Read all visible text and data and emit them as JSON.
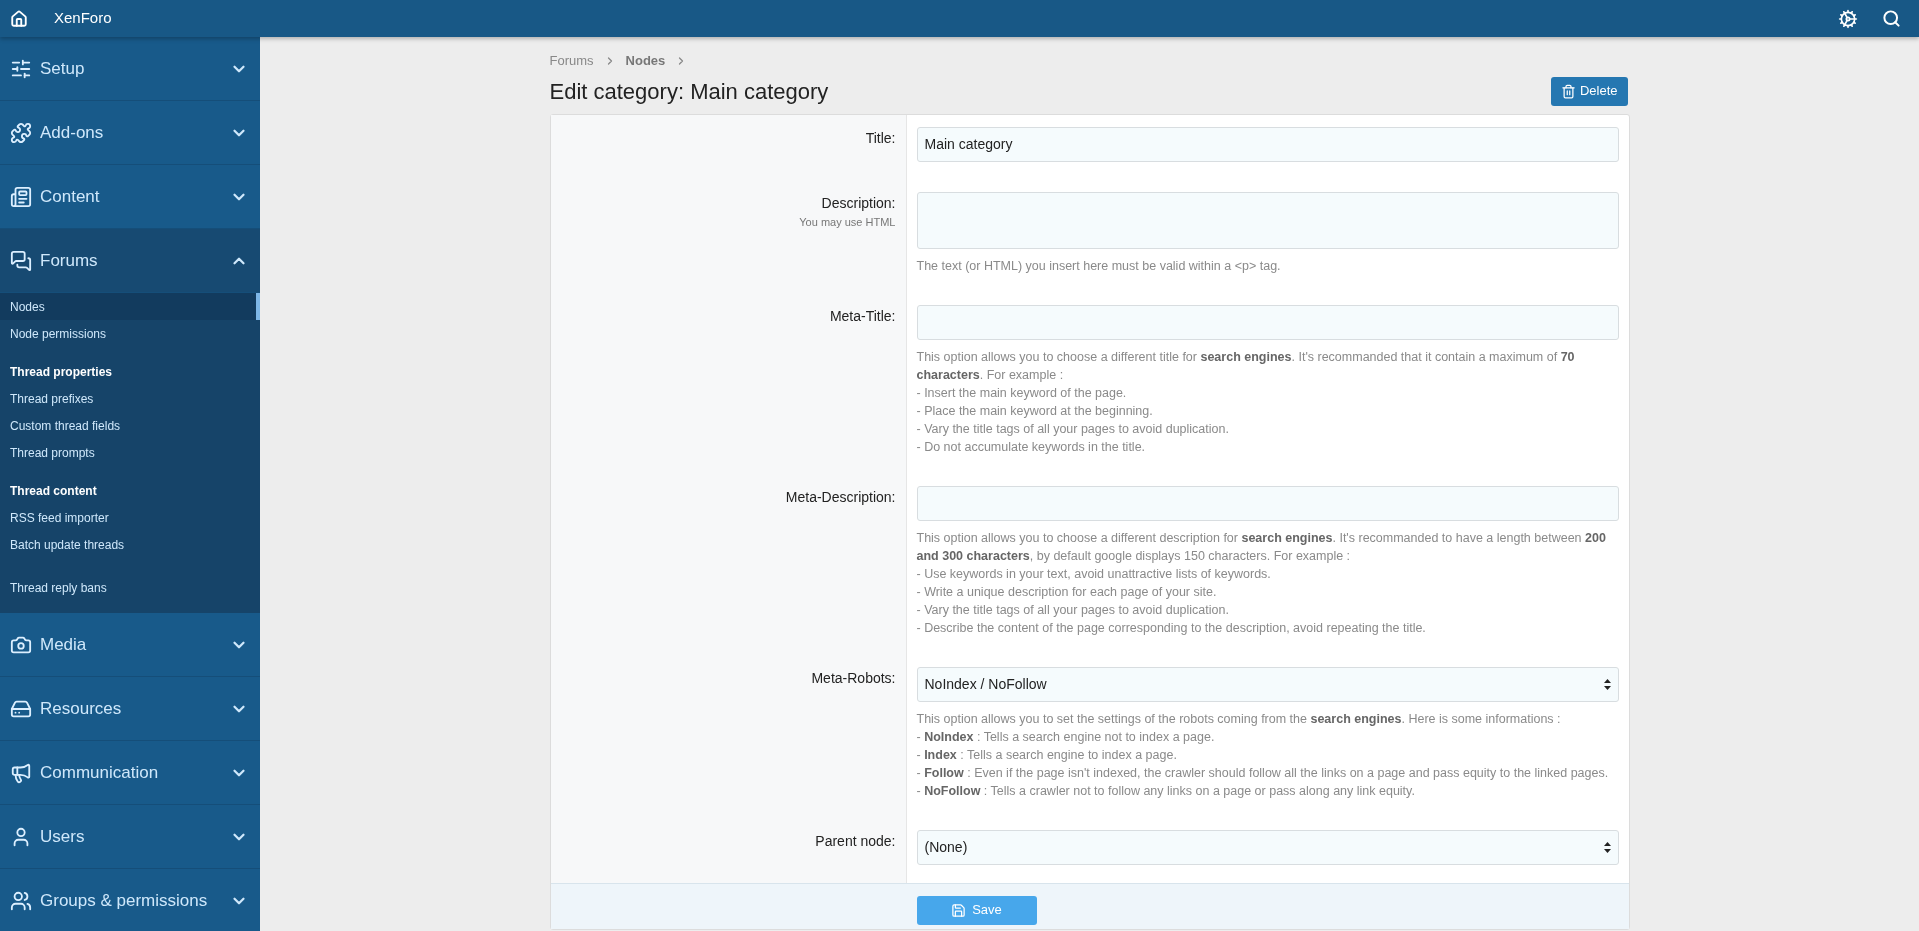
{
  "header": {
    "title": "XenForo"
  },
  "sidebar": {
    "sections": [
      {
        "label": "Setup",
        "expanded": false
      },
      {
        "label": "Add-ons",
        "expanded": false
      },
      {
        "label": "Content",
        "expanded": false
      },
      {
        "label": "Forums",
        "expanded": true,
        "items": [
          {
            "kind": "link",
            "label": "Nodes",
            "selected": true
          },
          {
            "kind": "link",
            "label": "Node permissions",
            "selected": false
          },
          {
            "kind": "heading",
            "label": "Thread properties"
          },
          {
            "kind": "link",
            "label": "Thread prefixes",
            "selected": false
          },
          {
            "kind": "link",
            "label": "Custom thread fields",
            "selected": false
          },
          {
            "kind": "link",
            "label": "Thread prompts",
            "selected": false
          },
          {
            "kind": "heading",
            "label": "Thread content"
          },
          {
            "kind": "link",
            "label": "RSS feed importer",
            "selected": false
          },
          {
            "kind": "link",
            "label": "Batch update threads",
            "selected": false
          },
          {
            "kind": "spacer"
          },
          {
            "kind": "link",
            "label": "Thread reply bans",
            "selected": false
          }
        ]
      },
      {
        "label": "Media",
        "expanded": false
      },
      {
        "label": "Resources",
        "expanded": false
      },
      {
        "label": "Communication",
        "expanded": false
      },
      {
        "label": "Users",
        "expanded": false
      },
      {
        "label": "Groups & permissions",
        "expanded": false
      }
    ]
  },
  "breadcrumbs": [
    {
      "label": "Forums",
      "current": false
    },
    {
      "label": "Nodes",
      "current": true
    }
  ],
  "page_title": "Edit category: Main category",
  "delete_button": "Delete",
  "fields": [
    {
      "kind": "text",
      "label": "Title:",
      "value": "Main category"
    },
    {
      "kind": "textarea",
      "label": "Description:",
      "hint": "You may use HTML",
      "explain": [
        "The text (or HTML) you insert here must be valid within a <p> tag."
      ]
    },
    {
      "kind": "text",
      "label": "Meta-Title:",
      "explain": [
        "This option allows you to choose a different title for **search engines**. It's recommanded that it contain a maximum of **70 characters**. For example :",
        "- Insert the main keyword of the page.",
        "- Place the main keyword at the beginning.",
        "- Vary the title tags of all your pages to avoid duplication.",
        "- Do not accumulate keywords in the title."
      ]
    },
    {
      "kind": "text",
      "label": "Meta-Description:",
      "explain": [
        "This option allows you to choose a different description for **search engines**. It's recommanded to have a length between **200 and 300 characters**, by default google displays 150 characters. For example :",
        "- Use keywords in your text, avoid unattractive lists of keywords.",
        "- Write a unique description for each page of your site.",
        "- Vary the title tags of all your pages to avoid duplication.",
        "- Describe the content of the page corresponding to the description, avoid repeating the title."
      ]
    },
    {
      "kind": "select",
      "label": "Meta-Robots:",
      "value": "NoIndex / NoFollow",
      "explain": [
        "This option allows you to set the settings of the robots coming from the **search engines**. Here is some informations :",
        "- **NoIndex** : Tells a search engine not to index a page.",
        "- **Index** : Tells a search engine to index a page.",
        "- **Follow** : Even if the page isn't indexed, the crawler should follow all the links on a page and pass equity to the linked pages.",
        "- **NoFollow** : Tells a crawler not to follow any links on a page or pass along any link equity."
      ]
    },
    {
      "kind": "select",
      "label": "Parent node:",
      "value": "(None)"
    }
  ],
  "save_button": "Save"
}
